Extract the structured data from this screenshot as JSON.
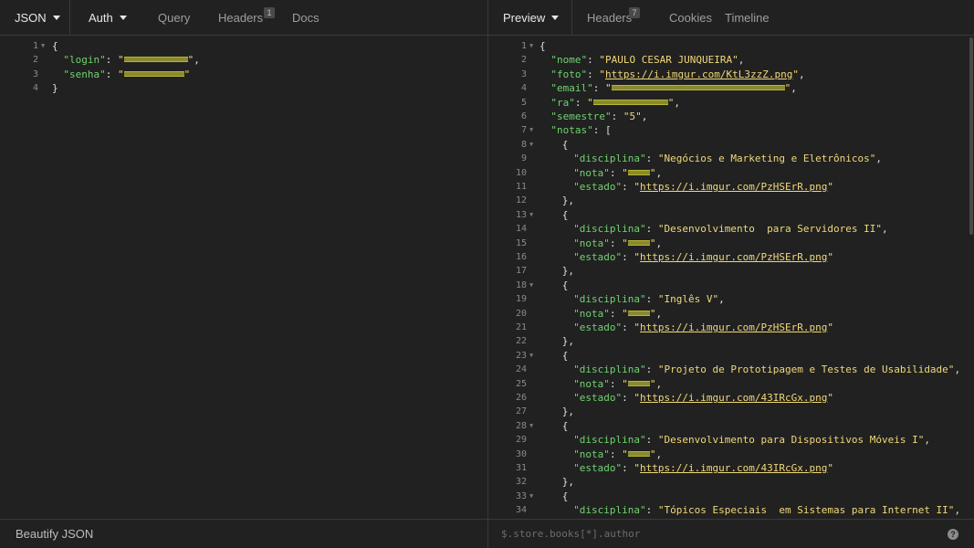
{
  "request": {
    "tabs": {
      "body": "JSON",
      "auth": "Auth",
      "query": "Query",
      "headers": "Headers",
      "headers_count": "1",
      "docs": "Docs"
    },
    "beautify_label": "Beautify JSON",
    "lines": [
      {
        "n": "1",
        "fold": true,
        "indent": 0,
        "tokens": [
          {
            "t": "p",
            "v": "{"
          }
        ]
      },
      {
        "n": "2",
        "indent": 1,
        "tokens": [
          {
            "t": "k",
            "v": "\"login\""
          },
          {
            "t": "p",
            "v": ": "
          },
          {
            "t": "s",
            "v": "\""
          },
          {
            "t": "r",
            "w": 70
          },
          {
            "t": "s",
            "v": "\""
          },
          {
            "t": "p",
            "v": ","
          }
        ]
      },
      {
        "n": "3",
        "indent": 1,
        "tokens": [
          {
            "t": "k",
            "v": "\"senha\""
          },
          {
            "t": "p",
            "v": ": "
          },
          {
            "t": "s",
            "v": "\""
          },
          {
            "t": "r",
            "w": 66
          },
          {
            "t": "s",
            "v": "\""
          }
        ]
      },
      {
        "n": "4",
        "indent": 0,
        "tokens": [
          {
            "t": "p",
            "v": "}"
          }
        ]
      }
    ]
  },
  "response": {
    "tabs": {
      "preview": "Preview",
      "headers": "Headers",
      "headers_count": "7",
      "cookies": "Cookies",
      "timeline": "Timeline"
    },
    "filter_placeholder": "$.store.books[*].author",
    "help_glyph": "?",
    "lines": [
      {
        "n": "1",
        "fold": true,
        "indent": 0,
        "tokens": [
          {
            "t": "p",
            "v": "{"
          }
        ]
      },
      {
        "n": "2",
        "indent": 1,
        "tokens": [
          {
            "t": "k",
            "v": "\"nome\""
          },
          {
            "t": "p",
            "v": ": "
          },
          {
            "t": "s",
            "v": "\"PAULO CESAR JUNQUEIRA\""
          },
          {
            "t": "p",
            "v": ","
          }
        ]
      },
      {
        "n": "3",
        "indent": 1,
        "tokens": [
          {
            "t": "k",
            "v": "\"foto\""
          },
          {
            "t": "p",
            "v": ": "
          },
          {
            "t": "s",
            "v": "\""
          },
          {
            "t": "u",
            "v": "https://i.imgur.com/KtL3zzZ.png"
          },
          {
            "t": "s",
            "v": "\""
          },
          {
            "t": "p",
            "v": ","
          }
        ]
      },
      {
        "n": "4",
        "indent": 1,
        "tokens": [
          {
            "t": "k",
            "v": "\"email\""
          },
          {
            "t": "p",
            "v": ": "
          },
          {
            "t": "s",
            "v": "\""
          },
          {
            "t": "r",
            "w": 190
          },
          {
            "t": "s",
            "v": "\""
          },
          {
            "t": "p",
            "v": ","
          }
        ]
      },
      {
        "n": "5",
        "indent": 1,
        "tokens": [
          {
            "t": "k",
            "v": "\"ra\""
          },
          {
            "t": "p",
            "v": ": "
          },
          {
            "t": "s",
            "v": "\""
          },
          {
            "t": "r",
            "w": 82
          },
          {
            "t": "s",
            "v": "\""
          },
          {
            "t": "p",
            "v": ","
          }
        ]
      },
      {
        "n": "6",
        "indent": 1,
        "tokens": [
          {
            "t": "k",
            "v": "\"semestre\""
          },
          {
            "t": "p",
            "v": ": "
          },
          {
            "t": "s",
            "v": "\"5\""
          },
          {
            "t": "p",
            "v": ","
          }
        ]
      },
      {
        "n": "7",
        "fold": true,
        "indent": 1,
        "tokens": [
          {
            "t": "k",
            "v": "\"notas\""
          },
          {
            "t": "p",
            "v": ": ["
          }
        ]
      },
      {
        "n": "8",
        "fold": true,
        "indent": 2,
        "tokens": [
          {
            "t": "p",
            "v": "{"
          }
        ]
      },
      {
        "n": "9",
        "indent": 3,
        "tokens": [
          {
            "t": "k",
            "v": "\"disciplina\""
          },
          {
            "t": "p",
            "v": ": "
          },
          {
            "t": "s",
            "v": "\"Negócios e Marketing e Eletrônicos\""
          },
          {
            "t": "p",
            "v": ","
          }
        ]
      },
      {
        "n": "10",
        "indent": 3,
        "tokens": [
          {
            "t": "k",
            "v": "\"nota\""
          },
          {
            "t": "p",
            "v": ": "
          },
          {
            "t": "s",
            "v": "\""
          },
          {
            "t": "r",
            "w": 24
          },
          {
            "t": "s",
            "v": "\""
          },
          {
            "t": "p",
            "v": ","
          }
        ]
      },
      {
        "n": "11",
        "indent": 3,
        "tokens": [
          {
            "t": "k",
            "v": "\"estado\""
          },
          {
            "t": "p",
            "v": ": "
          },
          {
            "t": "s",
            "v": "\""
          },
          {
            "t": "u",
            "v": "https://i.imgur.com/PzHSErR.png"
          },
          {
            "t": "s",
            "v": "\""
          }
        ]
      },
      {
        "n": "12",
        "indent": 2,
        "tokens": [
          {
            "t": "p",
            "v": "},"
          }
        ]
      },
      {
        "n": "13",
        "fold": true,
        "indent": 2,
        "tokens": [
          {
            "t": "p",
            "v": "{"
          }
        ]
      },
      {
        "n": "14",
        "indent": 3,
        "tokens": [
          {
            "t": "k",
            "v": "\"disciplina\""
          },
          {
            "t": "p",
            "v": ": "
          },
          {
            "t": "s",
            "v": "\"Desenvolvimento  para Servidores II\""
          },
          {
            "t": "p",
            "v": ","
          }
        ]
      },
      {
        "n": "15",
        "indent": 3,
        "tokens": [
          {
            "t": "k",
            "v": "\"nota\""
          },
          {
            "t": "p",
            "v": ": "
          },
          {
            "t": "s",
            "v": "\""
          },
          {
            "t": "r",
            "w": 24
          },
          {
            "t": "s",
            "v": "\""
          },
          {
            "t": "p",
            "v": ","
          }
        ]
      },
      {
        "n": "16",
        "indent": 3,
        "tokens": [
          {
            "t": "k",
            "v": "\"estado\""
          },
          {
            "t": "p",
            "v": ": "
          },
          {
            "t": "s",
            "v": "\""
          },
          {
            "t": "u",
            "v": "https://i.imgur.com/PzHSErR.png"
          },
          {
            "t": "s",
            "v": "\""
          }
        ]
      },
      {
        "n": "17",
        "indent": 2,
        "tokens": [
          {
            "t": "p",
            "v": "},"
          }
        ]
      },
      {
        "n": "18",
        "fold": true,
        "indent": 2,
        "tokens": [
          {
            "t": "p",
            "v": "{"
          }
        ]
      },
      {
        "n": "19",
        "indent": 3,
        "tokens": [
          {
            "t": "k",
            "v": "\"disciplina\""
          },
          {
            "t": "p",
            "v": ": "
          },
          {
            "t": "s",
            "v": "\"Inglês V\""
          },
          {
            "t": "p",
            "v": ","
          }
        ]
      },
      {
        "n": "20",
        "indent": 3,
        "tokens": [
          {
            "t": "k",
            "v": "\"nota\""
          },
          {
            "t": "p",
            "v": ": "
          },
          {
            "t": "s",
            "v": "\""
          },
          {
            "t": "r",
            "w": 24
          },
          {
            "t": "s",
            "v": "\""
          },
          {
            "t": "p",
            "v": ","
          }
        ]
      },
      {
        "n": "21",
        "indent": 3,
        "tokens": [
          {
            "t": "k",
            "v": "\"estado\""
          },
          {
            "t": "p",
            "v": ": "
          },
          {
            "t": "s",
            "v": "\""
          },
          {
            "t": "u",
            "v": "https://i.imgur.com/PzHSErR.png"
          },
          {
            "t": "s",
            "v": "\""
          }
        ]
      },
      {
        "n": "22",
        "indent": 2,
        "tokens": [
          {
            "t": "p",
            "v": "},"
          }
        ]
      },
      {
        "n": "23",
        "fold": true,
        "indent": 2,
        "tokens": [
          {
            "t": "p",
            "v": "{"
          }
        ]
      },
      {
        "n": "24",
        "indent": 3,
        "tokens": [
          {
            "t": "k",
            "v": "\"disciplina\""
          },
          {
            "t": "p",
            "v": ": "
          },
          {
            "t": "s",
            "v": "\"Projeto de Prototipagem e Testes de Usabilidade\""
          },
          {
            "t": "p",
            "v": ","
          }
        ]
      },
      {
        "n": "25",
        "indent": 3,
        "tokens": [
          {
            "t": "k",
            "v": "\"nota\""
          },
          {
            "t": "p",
            "v": ": "
          },
          {
            "t": "s",
            "v": "\""
          },
          {
            "t": "r",
            "w": 24
          },
          {
            "t": "s",
            "v": "\""
          },
          {
            "t": "p",
            "v": ","
          }
        ]
      },
      {
        "n": "26",
        "indent": 3,
        "tokens": [
          {
            "t": "k",
            "v": "\"estado\""
          },
          {
            "t": "p",
            "v": ": "
          },
          {
            "t": "s",
            "v": "\""
          },
          {
            "t": "u",
            "v": "https://i.imgur.com/43IRcGx.png"
          },
          {
            "t": "s",
            "v": "\""
          }
        ]
      },
      {
        "n": "27",
        "indent": 2,
        "tokens": [
          {
            "t": "p",
            "v": "},"
          }
        ]
      },
      {
        "n": "28",
        "fold": true,
        "indent": 2,
        "tokens": [
          {
            "t": "p",
            "v": "{"
          }
        ]
      },
      {
        "n": "29",
        "indent": 3,
        "tokens": [
          {
            "t": "k",
            "v": "\"disciplina\""
          },
          {
            "t": "p",
            "v": ": "
          },
          {
            "t": "s",
            "v": "\"Desenvolvimento para Dispositivos Móveis I\""
          },
          {
            "t": "p",
            "v": ","
          }
        ]
      },
      {
        "n": "30",
        "indent": 3,
        "tokens": [
          {
            "t": "k",
            "v": "\"nota\""
          },
          {
            "t": "p",
            "v": ": "
          },
          {
            "t": "s",
            "v": "\""
          },
          {
            "t": "r",
            "w": 24
          },
          {
            "t": "s",
            "v": "\""
          },
          {
            "t": "p",
            "v": ","
          }
        ]
      },
      {
        "n": "31",
        "indent": 3,
        "tokens": [
          {
            "t": "k",
            "v": "\"estado\""
          },
          {
            "t": "p",
            "v": ": "
          },
          {
            "t": "s",
            "v": "\""
          },
          {
            "t": "u",
            "v": "https://i.imgur.com/43IRcGx.png"
          },
          {
            "t": "s",
            "v": "\""
          }
        ]
      },
      {
        "n": "32",
        "indent": 2,
        "tokens": [
          {
            "t": "p",
            "v": "},"
          }
        ]
      },
      {
        "n": "33",
        "fold": true,
        "indent": 2,
        "tokens": [
          {
            "t": "p",
            "v": "{"
          }
        ]
      },
      {
        "n": "34",
        "indent": 3,
        "tokens": [
          {
            "t": "k",
            "v": "\"disciplina\""
          },
          {
            "t": "p",
            "v": ": "
          },
          {
            "t": "s",
            "v": "\"Tópicos Especiais  em Sistemas para Internet II\""
          },
          {
            "t": "p",
            "v": ","
          }
        ]
      }
    ]
  },
  "colors": {
    "background": "#212121",
    "key": "#6fd36f",
    "string": "#f0d878",
    "line_number": "#8a8a8a",
    "border": "#3a3a3a"
  }
}
